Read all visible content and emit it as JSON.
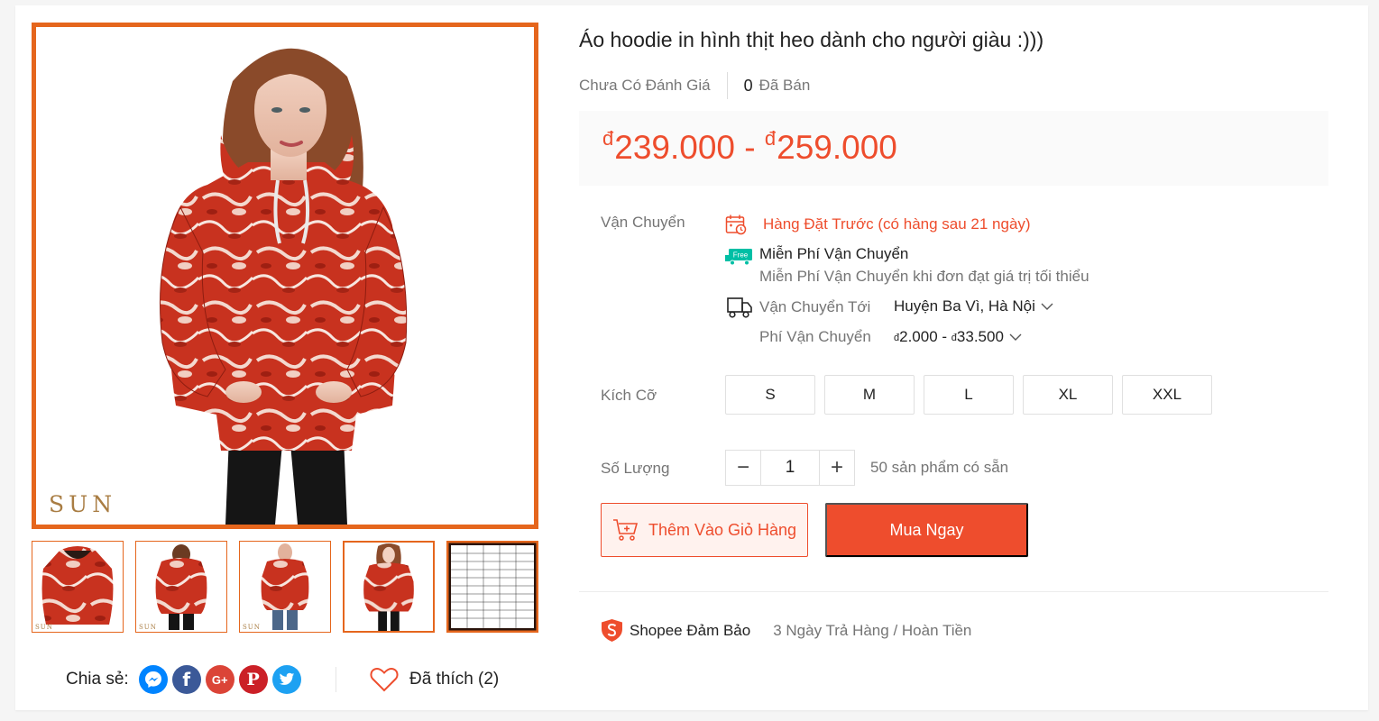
{
  "product": {
    "title": "Áo hoodie in hình thịt heo dành cho người giàu :)))",
    "rating_text": "Chưa Có Đánh Giá",
    "sold_count": "0",
    "sold_label": "Đã Bán",
    "price": {
      "currency": "đ",
      "min": "239.000",
      "separator": "-",
      "max": "259.000"
    }
  },
  "gallery": {
    "watermark": "SUN",
    "thumbnails": [
      {
        "name": "thumb-hoodie-front"
      },
      {
        "name": "thumb-hoodie-back"
      },
      {
        "name": "thumb-hoodie-model-man"
      },
      {
        "name": "thumb-hoodie-model-woman",
        "active": true
      },
      {
        "name": "thumb-size-chart"
      }
    ]
  },
  "shipping": {
    "label": "Vận Chuyển",
    "preorder_text": "Hàng Đặt Trước (có hàng sau 21 ngày)",
    "free_badge": "Free",
    "free_title": "Miễn Phí Vận Chuyển",
    "free_subtitle": "Miễn Phí Vận Chuyển khi đơn đạt giá trị tối thiểu",
    "to_label": "Vận Chuyển Tới",
    "to_value": "Huyện Ba Vì, Hà Nội",
    "fee_label": "Phí Vận Chuyển",
    "fee_currency": "đ",
    "fee_min": "2.000",
    "fee_max": "33.500"
  },
  "size": {
    "label": "Kích Cỡ",
    "options": [
      "S",
      "M",
      "L",
      "XL",
      "XXL"
    ]
  },
  "quantity": {
    "label": "Số Lượng",
    "minus": "−",
    "value": "1",
    "plus": "+",
    "stock_text": "50 sản phẩm có sẵn"
  },
  "actions": {
    "add_to_cart": "Thêm Vào Giỏ Hàng",
    "buy_now": "Mua Ngay"
  },
  "guarantee": {
    "title": "Shopee Đảm Bảo",
    "description": "3 Ngày Trả Hàng / Hoàn Tiền"
  },
  "share": {
    "label": "Chia sẻ:",
    "networks": [
      "messenger",
      "facebook",
      "google-plus",
      "pinterest",
      "twitter"
    ],
    "facebook_glyph": "f",
    "google_glyph": "G+",
    "pinterest_glyph": "P"
  },
  "like": {
    "text": "Đã thích (2)"
  },
  "colors": {
    "accent": "#ee4d2d",
    "image_border": "#e5661d"
  }
}
